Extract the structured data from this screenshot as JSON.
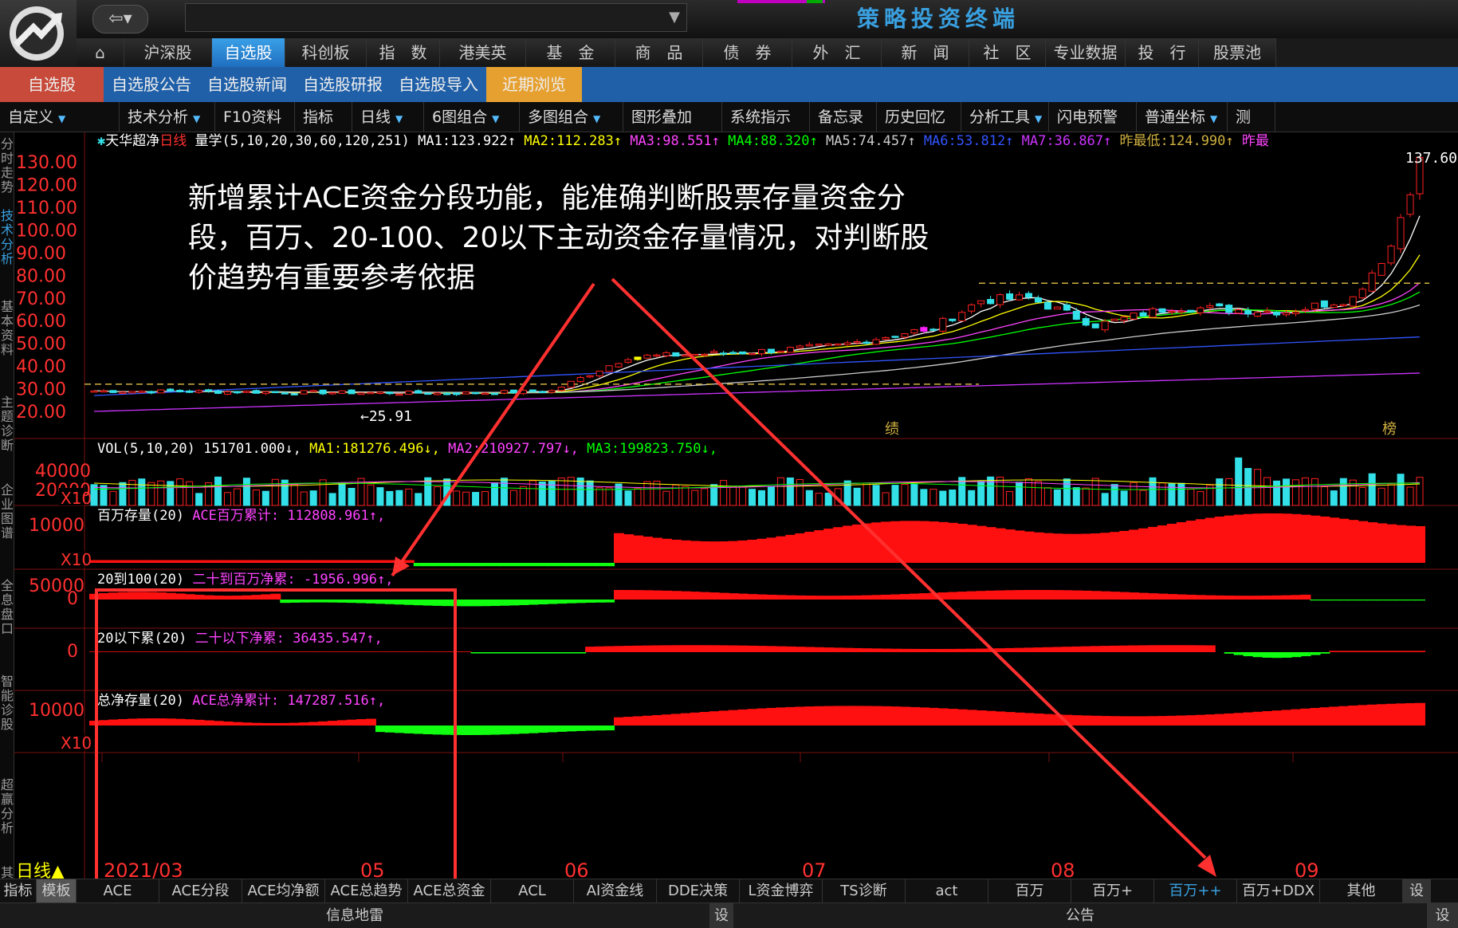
{
  "app": {
    "title": "策略投资终端"
  },
  "nav": {
    "main": [
      "沪深股",
      "自选股",
      "科创板",
      "指　数",
      "港美英",
      "基　金",
      "商　品",
      "债　券",
      "外　汇",
      "新　闻",
      "社　区",
      "专业数据",
      "投　行",
      "股票池"
    ],
    "active_main": "自选股",
    "sub": [
      "自选股",
      "自选股公告",
      "自选股新闻",
      "自选股研报",
      "自选股导入",
      "近期浏览"
    ]
  },
  "toolbar": {
    "items": [
      "自定义",
      "技术分析",
      "F10资料",
      "指标",
      "日线",
      "6图组合",
      "多图组合",
      "图形叠加",
      "系统指示",
      "备忘录",
      "历史回忆",
      "分析工具",
      "闪电预警",
      "普通坐标",
      "测"
    ]
  },
  "side_tabs": [
    "分时走势",
    "技术分析",
    "基本资料",
    "主题诊断",
    "企业图谱",
    "全息盘口",
    "智能诊股",
    "超赢分析",
    "其他"
  ],
  "stock": {
    "name": "天华超净",
    "period": "日线",
    "indicator": "量学(5,10,20,30,60,120,251)"
  },
  "ma_readout": [
    {
      "label": "MA1:",
      "value": "123.922↑",
      "color": "#ffffff"
    },
    {
      "label": "MA2:",
      "value": "112.283↑",
      "color": "#ffff00"
    },
    {
      "label": "MA3:",
      "value": "98.551↑",
      "color": "#ff44ff"
    },
    {
      "label": "MA4:",
      "value": "88.320↑",
      "color": "#00ff00"
    },
    {
      "label": "MA5:",
      "value": "74.457↑",
      "color": "#cccccc"
    },
    {
      "label": "MA6:",
      "value": "53.812↑",
      "color": "#3355ff"
    },
    {
      "label": "MA7:",
      "value": "36.867↑",
      "color": "#cc33ff"
    },
    {
      "label": "昨最低:",
      "value": "124.990↑",
      "color": "#d0b040"
    },
    {
      "label": "昨最",
      "value": "",
      "color": "#ff44ff"
    }
  ],
  "price_panel": {
    "y_ticks": [
      "130.00",
      "120.00",
      "110.00",
      "100.00",
      "90.00",
      "80.00",
      "70.00",
      "60.00",
      "50.00",
      "40.00",
      "30.00",
      "20.00"
    ],
    "high_label": "137.60",
    "low_label": "←25.91",
    "event_labels": [
      "绩",
      "榜"
    ]
  },
  "volume_panel": {
    "header": "VOL(5,10,20)",
    "value": "151701.000↓",
    "ma": [
      {
        "label": "MA1:",
        "value": "181276.496↓",
        "color": "#ffff00"
      },
      {
        "label": "MA2:",
        "value": "210927.797↓",
        "color": "#ff44ff"
      },
      {
        "label": "MA3:",
        "value": "199823.750↓",
        "color": "#00ff00"
      }
    ],
    "y_ticks": [
      "40000",
      "20000"
    ],
    "unit": "X10"
  },
  "ace_panels": [
    {
      "title": "百万存量(20)",
      "label": "ACE百万累计:",
      "value": "112808.961↑,",
      "y_ticks": [
        "10000"
      ],
      "unit": "X10"
    },
    {
      "title": "20到100(20)",
      "label": "二十到百万净累:",
      "value": "-1956.996↑,",
      "y_ticks": [
        "50000",
        "0"
      ],
      "unit": ""
    },
    {
      "title": "20以下累(20)",
      "label": "二十以下净累:",
      "value": "36435.547↑,",
      "y_ticks": [
        "0"
      ],
      "unit": ""
    },
    {
      "title": "总净存量(20)",
      "label": "ACE总净累计:",
      "value": "147287.516↑,",
      "y_ticks": [
        "10000"
      ],
      "unit": "X10"
    }
  ],
  "x_axis": {
    "labels": [
      "2021/03",
      "05",
      "06",
      "07",
      "08",
      "09"
    ],
    "period_tag": "日线▲"
  },
  "annotation": "新增累计ACE资金分段功能，能准确判断股票存量资金分段，百万、20-100、20以下主动资金存量情况，对判断股价趋势有重要参考依据",
  "bottom_tabs": [
    "指标",
    "模板",
    "ACE",
    "ACE分段",
    "ACE均净额",
    "ACE总趋势",
    "ACE总资金",
    "ACL",
    "AI资金线",
    "DDE决策",
    "L资金博弈",
    "TS诊断",
    "act",
    "百万",
    "百万+",
    "百万++",
    "百万+DDX",
    "其他",
    "设"
  ],
  "active_bottom_tab": "百万++",
  "status": {
    "left": "信息地雷",
    "set": "设",
    "right": "公告",
    "set2": "设"
  },
  "colors": {
    "up": "#ff2020",
    "down": "#33e0e8",
    "pos_area": "#ff1010",
    "neg_area": "#10ff10",
    "accent": "#2a90e0",
    "tab_active": "#e6a030"
  }
}
